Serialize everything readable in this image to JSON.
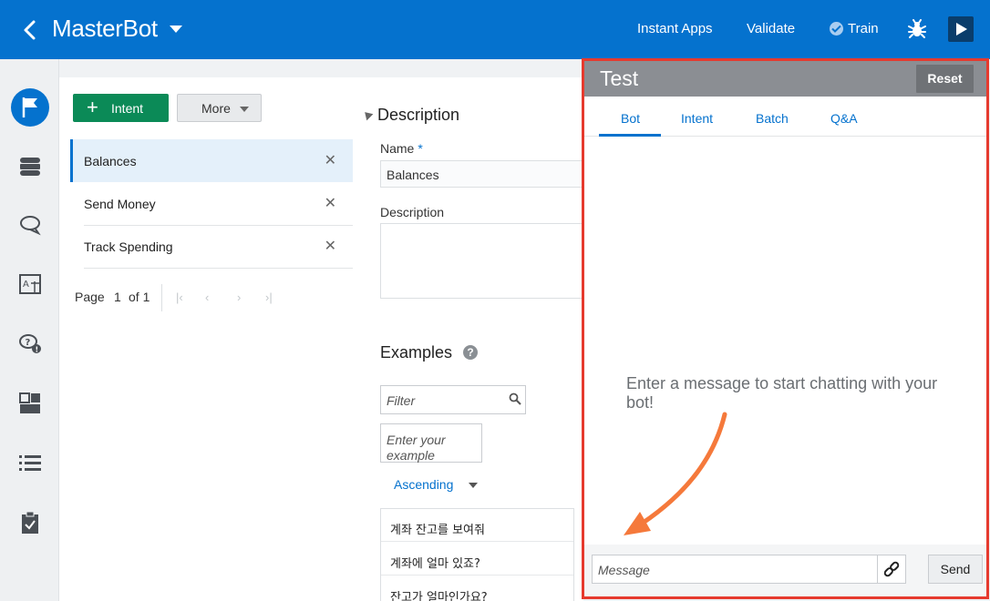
{
  "header": {
    "title": "MasterBot",
    "links": {
      "instant_apps": "Instant Apps",
      "validate": "Validate",
      "train": "Train"
    }
  },
  "rail": {
    "icons": [
      "intents-flag-icon",
      "entities-database-icon",
      "flows-chat-icon",
      "resource-bundles-icon",
      "faq-help-icon",
      "components-icon",
      "insights-list-icon",
      "quality-clipboard-icon"
    ]
  },
  "intents": {
    "add_button": "Intent",
    "more_button": "More",
    "items": [
      {
        "label": "Balances",
        "selected": true
      },
      {
        "label": "Send Money",
        "selected": false
      },
      {
        "label": "Track Spending",
        "selected": false
      }
    ],
    "pager": {
      "page_label": "Page",
      "current": "1",
      "of_label": "of 1"
    }
  },
  "detail": {
    "heading": "Description",
    "name_label": "Name",
    "name_required": "*",
    "name_value": "Balances",
    "description_label": "Description",
    "examples_heading": "Examples",
    "filter_placeholder": "Filter",
    "example_placeholder": "Enter your example",
    "sort_label": "Ascending",
    "examples": [
      "계좌 잔고를 보여줘",
      "계좌에 얼마 있죠?",
      "잔고가 얼마인가요?"
    ]
  },
  "test_panel": {
    "title": "Test",
    "reset_button": "Reset",
    "tabs": [
      "Bot",
      "Intent",
      "Batch",
      "Q&A"
    ],
    "active_tab": "Bot",
    "hint": "Enter a message to start chatting with your bot!",
    "message_placeholder": "Message",
    "send_button": "Send"
  },
  "colors": {
    "header_bg": "#0572ce",
    "intent_button": "#0b8a57",
    "highlight_outline": "#e63a2e",
    "annotation_arrow": "#f5793b"
  }
}
